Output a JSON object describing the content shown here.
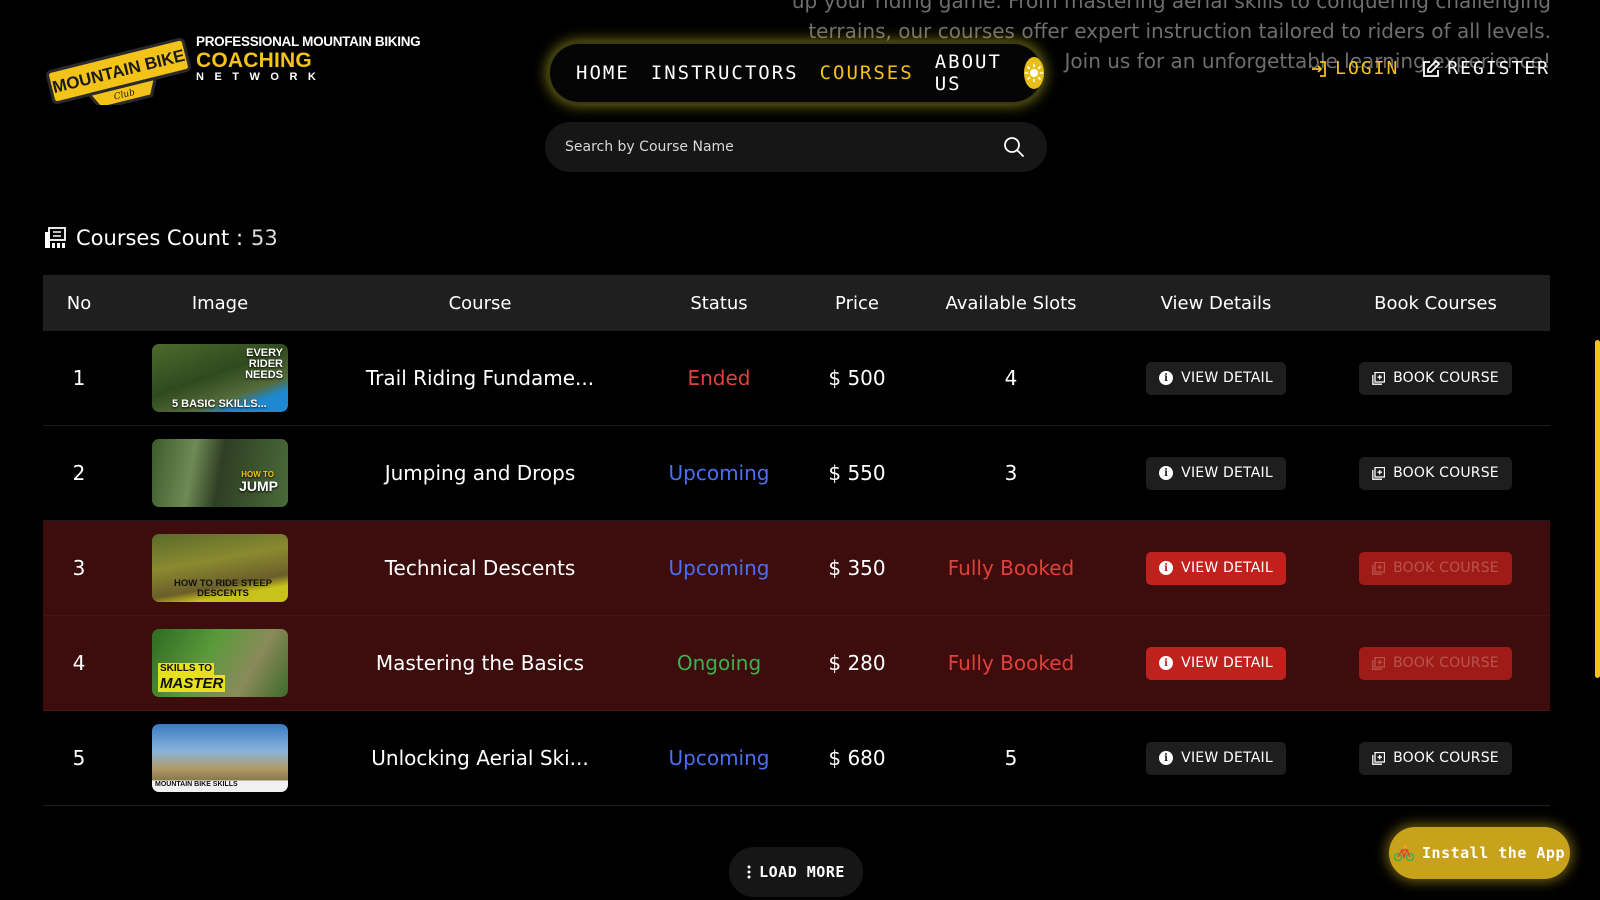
{
  "intro": {
    "text": "up your riding game. From mastering aerial skills to conquering challenging terrains, our courses offer expert instruction tailored to riders of all levels. Join us for an unforgettable learning experience!"
  },
  "logo": {
    "badge_text": "MOUNTAIN BIKE",
    "badge_sub": "Club",
    "line1": "PROFESSIONAL MOUNTAIN BIKING",
    "line2": "COACHING",
    "line3": "NETWORK"
  },
  "nav": {
    "items": [
      "HOME",
      "INSTRUCTORS",
      "COURSES",
      "ABOUT US"
    ],
    "active": "COURSES",
    "theme_icon": "sun-icon"
  },
  "auth": {
    "login": "LOGIN",
    "register": "REGISTER"
  },
  "search": {
    "placeholder": "Search by Course Name",
    "value": ""
  },
  "count": {
    "label": "Courses Count :",
    "value": "53"
  },
  "table": {
    "headers": [
      "No",
      "Image",
      "Course",
      "Status",
      "Price",
      "Available Slots",
      "View Details",
      "Book Courses"
    ],
    "rows": [
      {
        "no": "1",
        "thumb_caption_top": "EVERY RIDER NEEDS",
        "thumb_caption_bottom": "5 BASIC SKILLS...",
        "course": "Trail Riding Fundame...",
        "status": "Ended",
        "price": "$ 500",
        "slots": "4",
        "view": "VIEW DETAIL",
        "book": "BOOK COURSE"
      },
      {
        "no": "2",
        "thumb_caption_top": "HOW TO",
        "thumb_caption_bottom": "JUMP",
        "course": "Jumping and Drops",
        "status": "Upcoming",
        "price": "$ 550",
        "slots": "3",
        "view": "VIEW DETAIL",
        "book": "BOOK COURSE"
      },
      {
        "no": "3",
        "thumb_caption_top": "",
        "thumb_caption_bottom": "HOW TO RIDE STEEP DESCENTS",
        "course": "Technical Descents",
        "status": "Upcoming",
        "price": "$ 350",
        "slots": "Fully Booked",
        "view": "VIEW DETAIL",
        "book": "BOOK COURSE"
      },
      {
        "no": "4",
        "thumb_caption_top": "SKILLS TO",
        "thumb_caption_bottom": "MASTER",
        "course": "Mastering the Basics",
        "status": "Ongoing",
        "price": "$ 280",
        "slots": "Fully Booked",
        "view": "VIEW DETAIL",
        "book": "BOOK COURSE"
      },
      {
        "no": "5",
        "thumb_caption_top": "",
        "thumb_caption_bottom": "MOUNTAIN BIKE SKILLS",
        "course": "Unlocking Aerial Ski...",
        "status": "Upcoming",
        "price": "$ 680",
        "slots": "5",
        "view": "VIEW DETAIL",
        "book": "BOOK COURSE"
      }
    ]
  },
  "load_more": "LOAD MORE",
  "install": "Install the App",
  "colors": {
    "accent": "#f4c319",
    "ended": "#e0413a",
    "upcoming": "#4c6ff0",
    "ongoing": "#3bb34a",
    "booked_row": "#3d0c0c"
  }
}
